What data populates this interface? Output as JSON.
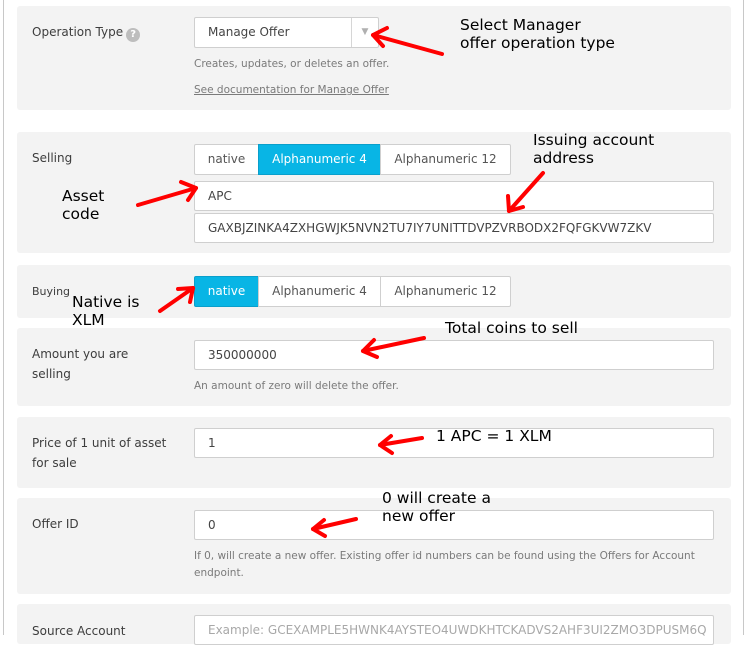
{
  "operation_type": {
    "label": "Operation Type",
    "help_icon": "?",
    "selected": "Manage Offer",
    "caret": "▼",
    "description": "Creates, updates, or deletes an offer.",
    "doc_link": "See documentation for Manage Offer"
  },
  "selling": {
    "label": "Selling",
    "tabs": [
      "native",
      "Alphanumeric 4",
      "Alphanumeric 12"
    ],
    "active_tab": "Alphanumeric 4",
    "asset_code": "APC",
    "issuer": "GAXBJZINKA4ZXHGWJK5NVN2TU7IY7UNITTDVPZVRBODX2FQFGKVW7ZKV"
  },
  "buying": {
    "label": "Buying",
    "tabs": [
      "native",
      "Alphanumeric 4",
      "Alphanumeric 12"
    ],
    "active_tab": "native"
  },
  "amount": {
    "label_line1": "Amount you are",
    "label_line2": "selling",
    "value": "350000000",
    "hint": "An amount of zero will delete the offer."
  },
  "price": {
    "label_line1": "Price of 1 unit of asset",
    "label_line2": "for sale",
    "value": "1"
  },
  "offer_id": {
    "label": "Offer ID",
    "value": "0",
    "hint_line1": "If 0, will create a new offer. Existing offer id numbers can be found using the Offers for Account",
    "hint_line2": "endpoint."
  },
  "source_account": {
    "label": "Source Account",
    "placeholder": "Example: GCEXAMPLE5HWNK4AYSTEO4UWDKHTCKADVS2AHF3UI2ZMO3DPUSM6Q"
  },
  "annotations": {
    "operation": [
      "Select Manager",
      "offer operation type"
    ],
    "issuer": [
      "Issuing account",
      "address"
    ],
    "asset_code": [
      "Asset",
      "code"
    ],
    "native": [
      "Native is",
      "XLM"
    ],
    "amount": "Total coins to sell",
    "price": "1 APC = 1 XLM",
    "offer_id": [
      "0 will create a",
      "new offer"
    ]
  },
  "colors": {
    "accent": "#08b5e5",
    "annotation_arrow": "#ff0000",
    "panel_bg": "#f3f3f3"
  }
}
